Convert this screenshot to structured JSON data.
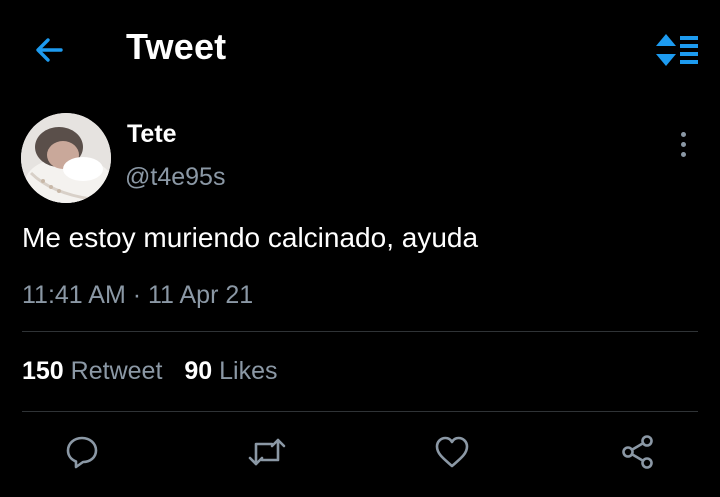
{
  "header": {
    "title": "Tweet",
    "back_icon": "arrow-left-icon",
    "sort_icon": "sort-list-icon"
  },
  "tweet": {
    "author_name": "Tete",
    "author_handle": "@t4e95s",
    "text": "Me estoy muriendo calcinado, ayuda",
    "timestamp": "11:41 AM · 11 Apr 21"
  },
  "stats": {
    "retweets_count": "150",
    "retweets_label": "Retweet",
    "likes_count": "90",
    "likes_label": "Likes"
  },
  "actions": [
    "reply-icon",
    "retweet-icon",
    "like-icon",
    "share-icon"
  ],
  "colors": {
    "background": "#000000",
    "accent": "#1d9bf0",
    "secondary_text": "#8b98a5",
    "divider": "#2f3336"
  }
}
